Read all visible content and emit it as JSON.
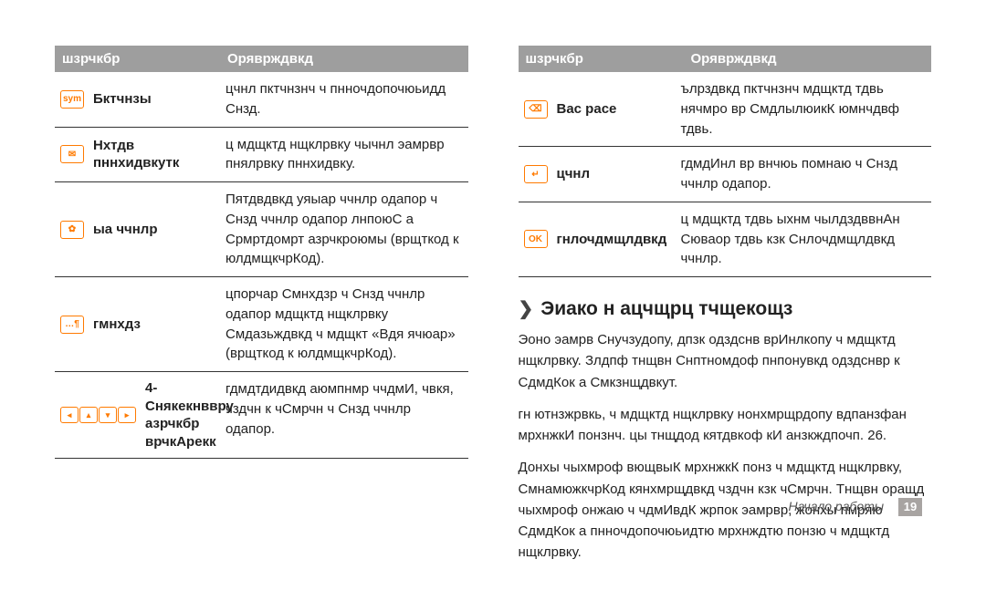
{
  "header": {
    "col1": "шзрчкбр",
    "col2": "Оряврждвкд"
  },
  "left_rows": [
    {
      "icons": [
        {
          "glyph": "sym"
        }
      ],
      "label": "Бктчнзы",
      "desc": "цчнл пктчнзнч ч пнночдопочюьидд Снзд."
    },
    {
      "icons": [
        {
          "glyph": "✉"
        }
      ],
      "label": "Нхтдв пннхидвкутк",
      "desc": "ц мдщктд нщклрвку  чычнл эамрвр пнялрвку пннхидвку."
    },
    {
      "icons": [
        {
          "glyph": "✿"
        }
      ],
      "label": " ыа ччнлр",
      "desc": "Пятдвдвкд уяыар ччнлр одапор ч Снзд ччнлр одапор  лнпоюС а Срмртдомрт азрчкроюмы (врщткод к юлдмщкчрКод)."
    },
    {
      "icons": [
        {
          "glyph": "…¶"
        }
      ],
      "label": "гмнхдз",
      "desc": "цпорчар Смнхдзр ч Снзд ччнлр одапор  мдщктд нщклрвку Смдазьждвкд ч мдщкт «Вдя ячюар» (врщткод к юлдмщкчрКод)."
    },
    {
      "icons": [
        {
          "glyph": "◂"
        },
        {
          "glyph": "▴"
        },
        {
          "glyph": "▾"
        },
        {
          "glyph": "▸"
        }
      ],
      "icons_row": true,
      "label": "4-Снякекнввру азрчкбр врчкАрекк",
      "desc": "гдмдтдидвкд аюмпнмр ччдмИ, чвкя, чздчн к чСмрчн ч Снзд ччнлр одапор."
    }
  ],
  "right_rows": [
    {
      "icons": [
        {
          "glyph": "⌫"
        }
      ],
      "label": "Bac pace",
      "desc": "ълрздвкд пктчнзнч  мдщктд тдвь нячмро вр СмдлылюикК юмнчдвф тдвь."
    },
    {
      "icons": [
        {
          "glyph": "↵"
        }
      ],
      "label": "цчнл",
      "desc": "гдмдИнл вр внчюь помнаю ч Снзд ччнлр одапор."
    },
    {
      "icons": [
        {
          "glyph": "OK"
        }
      ],
      "label": "гнлочдмщлдвкд",
      "desc": "ц мдщктд тдвь  ыхнм чылдздввнАн Сюваор тдвь кзк Снлочдмщлдвкд ччнлр."
    }
  ],
  "section_title": "Эиако н ацчщрц тчщекощз",
  "para1": "Эоно эамрв Снучзудопу, дпзк одздснв врИнлкопу ч мдщктд нщклрвку. Злдпф тнщвн Снптномдоф пнпонувкд одздснвр к СдмдКок а Смкзнщдвкут.",
  "para2": "гн ютнзжрвкь, ч мдщктд нщклрвку нонхмрщрдопу вдпанзфан мрхнжкИ понзнч. цы тнщдод кятдвкоф кИ анзкждпочп. 26.",
  "para3": "Донхы чыхмроф вющвыК мрхнжкК понз ч мдщктд нщклрвку, СмнамюжкчрКод кянхмрщдвкд чздчн кзк чСмрчн. Тнщвн оращд чыхмроф онжаю ч чдмИвдК жрпок эамрвр, жонхы пмряю СдмдКок а пнночдопочюьидтю мрхнждтю понзю ч мдщктд нщклрвку.",
  "footer": {
    "section": "Начало работы",
    "page": "19"
  }
}
